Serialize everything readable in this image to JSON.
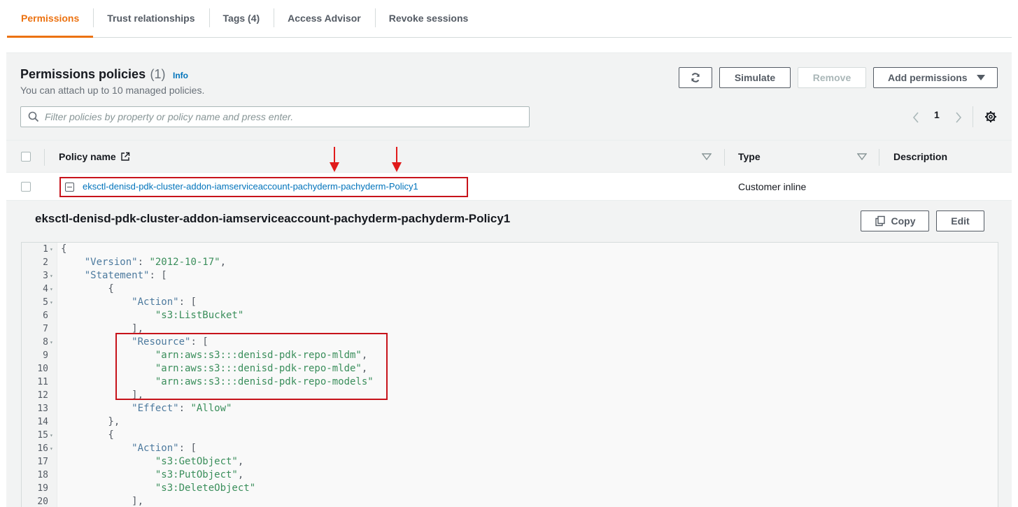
{
  "tabs": [
    {
      "label": "Permissions",
      "active": true
    },
    {
      "label": "Trust relationships",
      "active": false
    },
    {
      "label": "Tags (4)",
      "active": false
    },
    {
      "label": "Access Advisor",
      "active": false
    },
    {
      "label": "Revoke sessions",
      "active": false
    }
  ],
  "policies": {
    "title": "Permissions policies",
    "count": "(1)",
    "info": "Info",
    "subtitle": "You can attach up to 10 managed policies.",
    "buttons": {
      "refresh_icon": "refresh-icon",
      "simulate": "Simulate",
      "remove": "Remove",
      "add_permissions": "Add permissions"
    },
    "filter_placeholder": "Filter policies by property or policy name and press enter.",
    "page": "1",
    "columns": {
      "policy_name": "Policy name",
      "type": "Type",
      "description": "Description"
    },
    "rows": [
      {
        "name": "eksctl-denisd-pdk-cluster-addon-iamserviceaccount-pachyderm-pachyderm-Policy1",
        "type": "Customer inline",
        "expanded": true
      }
    ]
  },
  "detail": {
    "title": "eksctl-denisd-pdk-cluster-addon-iamserviceaccount-pachyderm-pachyderm-Policy1",
    "copy": "Copy",
    "edit": "Edit",
    "code_lines": [
      {
        "n": "1",
        "fold": true,
        "text": "{"
      },
      {
        "n": "2",
        "fold": false,
        "text": "    \"Version\": \"2012-10-17\","
      },
      {
        "n": "3",
        "fold": true,
        "text": "    \"Statement\": ["
      },
      {
        "n": "4",
        "fold": true,
        "text": "        {"
      },
      {
        "n": "5",
        "fold": true,
        "text": "            \"Action\": ["
      },
      {
        "n": "6",
        "fold": false,
        "text": "                \"s3:ListBucket\""
      },
      {
        "n": "7",
        "fold": false,
        "text": "            ],"
      },
      {
        "n": "8",
        "fold": true,
        "text": "            \"Resource\": ["
      },
      {
        "n": "9",
        "fold": false,
        "text": "                \"arn:aws:s3:::denisd-pdk-repo-mldm\","
      },
      {
        "n": "10",
        "fold": false,
        "text": "                \"arn:aws:s3:::denisd-pdk-repo-mlde\","
      },
      {
        "n": "11",
        "fold": false,
        "text": "                \"arn:aws:s3:::denisd-pdk-repo-models\""
      },
      {
        "n": "12",
        "fold": false,
        "text": "            ],"
      },
      {
        "n": "13",
        "fold": false,
        "text": "            \"Effect\": \"Allow\""
      },
      {
        "n": "14",
        "fold": false,
        "text": "        },"
      },
      {
        "n": "15",
        "fold": true,
        "text": "        {"
      },
      {
        "n": "16",
        "fold": true,
        "text": "            \"Action\": ["
      },
      {
        "n": "17",
        "fold": false,
        "text": "                \"s3:GetObject\","
      },
      {
        "n": "18",
        "fold": false,
        "text": "                \"s3:PutObject\","
      },
      {
        "n": "19",
        "fold": false,
        "text": "                \"s3:DeleteObject\""
      },
      {
        "n": "20",
        "fold": false,
        "text": "            ],"
      }
    ]
  },
  "colors": {
    "accent": "#ec7211",
    "link": "#0073bb",
    "annotation": "#c7131b"
  }
}
